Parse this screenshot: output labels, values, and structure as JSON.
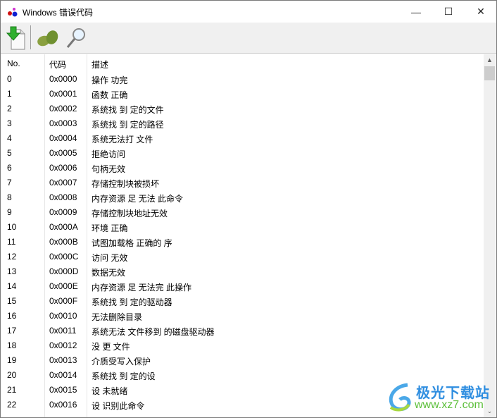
{
  "window": {
    "title": "Windows 错误代码",
    "minimize": "—",
    "maximize": "☐",
    "close": "✕"
  },
  "toolbar": {
    "buttons": [
      {
        "name": "export-icon"
      },
      {
        "name": "leaves-icon"
      },
      {
        "name": "search-icon"
      }
    ]
  },
  "list": {
    "columns": [
      "No.",
      "代码",
      "描述"
    ],
    "rows": [
      [
        "0",
        "0x0000",
        "操作 功完"
      ],
      [
        "1",
        "0x0001",
        "函数 正确"
      ],
      [
        "2",
        "0x0002",
        "系统找 到 定的文件"
      ],
      [
        "3",
        "0x0003",
        "系统找 到 定的路径"
      ],
      [
        "4",
        "0x0004",
        "系统无法打 文件"
      ],
      [
        "5",
        "0x0005",
        "拒绝访问"
      ],
      [
        "6",
        "0x0006",
        "句柄无效"
      ],
      [
        "7",
        "0x0007",
        "存储控制块被损坏"
      ],
      [
        "8",
        "0x0008",
        "内存资源 足 无法  此命令"
      ],
      [
        "9",
        "0x0009",
        "存储控制块地址无效"
      ],
      [
        "10",
        "0x000A",
        "环境 正确"
      ],
      [
        "11",
        "0x000B",
        "试图加载格  正确的 序"
      ],
      [
        "12",
        "0x000C",
        "访问 无效"
      ],
      [
        "13",
        "0x000D",
        "数据无效"
      ],
      [
        "14",
        "0x000E",
        "内存资源 足 无法完 此操作"
      ],
      [
        "15",
        "0x000F",
        "系统找 到 定的驱动器"
      ],
      [
        "16",
        "0x0010",
        "无法删除目录"
      ],
      [
        "17",
        "0x0011",
        "系统无法 文件移到  的磁盘驱动器"
      ],
      [
        "18",
        "0x0012",
        "没 更 文件"
      ],
      [
        "19",
        "0x0013",
        "介质受写入保护"
      ],
      [
        "20",
        "0x0014",
        "系统找 到 定的设"
      ],
      [
        "21",
        "0x0015",
        "设 未就绪"
      ],
      [
        "22",
        "0x0016",
        "设  识别此命令"
      ]
    ]
  },
  "watermark": {
    "name": "极光下载站",
    "url": "www.xz7.com"
  }
}
